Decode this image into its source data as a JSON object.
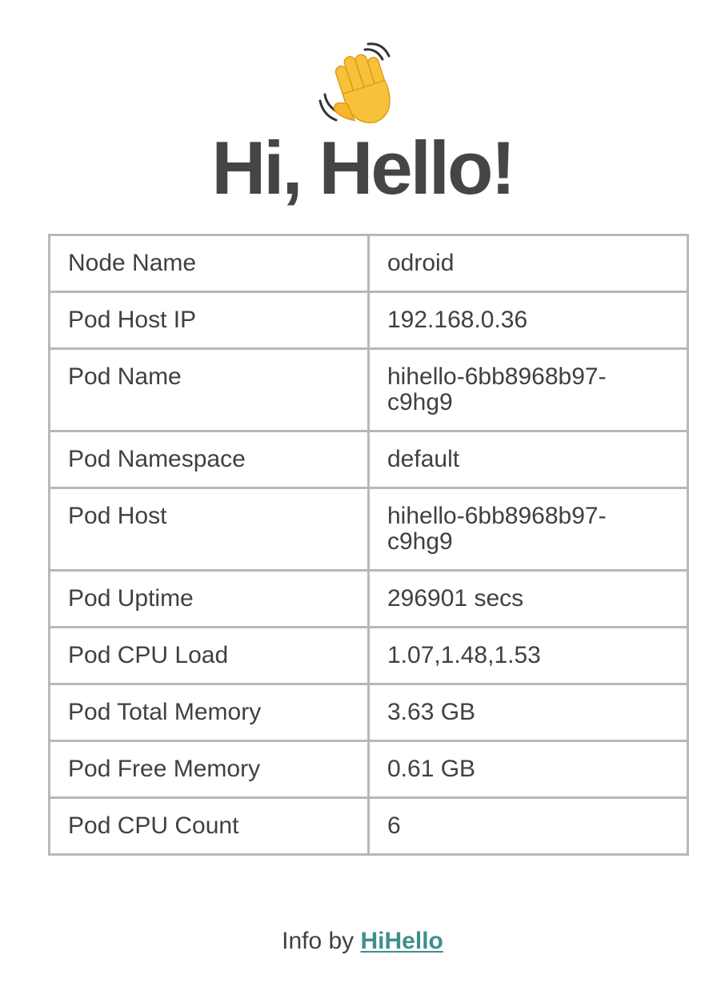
{
  "header": {
    "icon": "waving-hand-icon",
    "title": "Hi, Hello!"
  },
  "info_table": {
    "rows": [
      {
        "label": "Node Name",
        "value": "odroid"
      },
      {
        "label": "Pod Host IP",
        "value": "192.168.0.36"
      },
      {
        "label": "Pod Name",
        "value": "hihello-6bb8968b97-c9hg9"
      },
      {
        "label": "Pod Namespace",
        "value": "default"
      },
      {
        "label": "Pod Host",
        "value": "hihello-6bb8968b97-c9hg9"
      },
      {
        "label": "Pod Uptime",
        "value": "296901 secs"
      },
      {
        "label": "Pod CPU Load",
        "value": "1.07,1.48,1.53"
      },
      {
        "label": "Pod Total Memory",
        "value": "3.63 GB"
      },
      {
        "label": "Pod Free Memory",
        "value": "0.61 GB"
      },
      {
        "label": "Pod CPU Count",
        "value": "6"
      }
    ]
  },
  "footer": {
    "prefix": "Info by",
    "link_label": "HiHello"
  },
  "colors": {
    "text": "#404040",
    "title": "#454545",
    "border": "#b8b8b8",
    "link": "#3e8e8e",
    "emoji": "#f7c23a"
  }
}
